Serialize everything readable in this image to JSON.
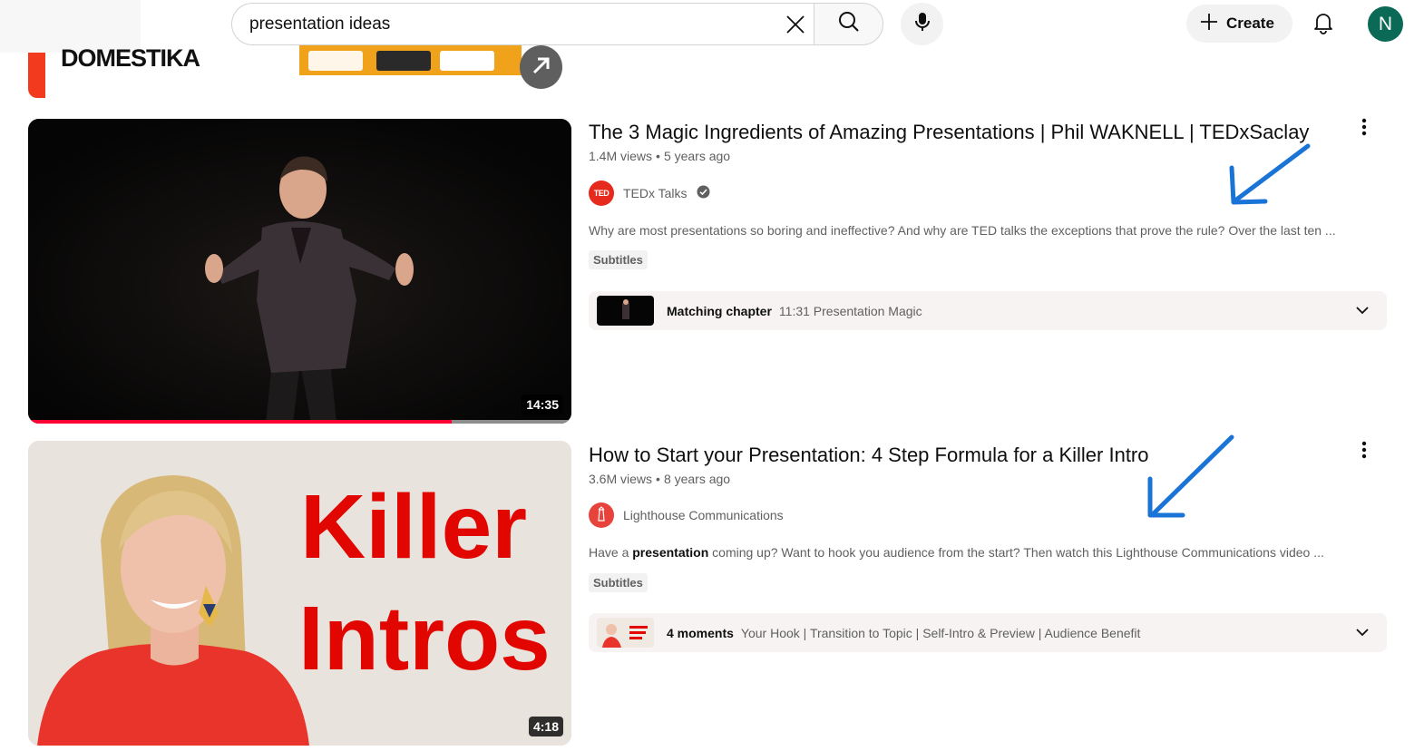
{
  "header": {
    "search_value": "presentation ideas",
    "search_placeholder": "Search",
    "create_label": "Create",
    "avatar_letter": "N"
  },
  "ad": {
    "brand": "DOMESTIKA"
  },
  "results": [
    {
      "title": "The 3 Magic Ingredients of Amazing Presentations | Phil WAKNELL | TEDxSaclay",
      "views": "1.4M views",
      "age": "5 years ago",
      "channel": "TEDx Talks",
      "channel_avatar_text": "TED",
      "verified": true,
      "description": "Why are most presentations so boring and ineffective? And why are TED talks the exceptions that prove the rule? Over the last ten ...",
      "badge": "Subtitles",
      "duration": "14:35",
      "watch_progress": 0.78,
      "chapter_label": "Matching chapter",
      "chapter_text": "11:31 Presentation Magic"
    },
    {
      "title": "How to Start your Presentation: 4 Step Formula for a Killer Intro",
      "views": "3.6M views",
      "age": "8 years ago",
      "channel": "Lighthouse Communications",
      "description_pre": "Have a ",
      "description_bold": "presentation",
      "description_post": " coming up? Want to hook you audience from the start? Then watch this Lighthouse Communications video ...",
      "badge": "Subtitles",
      "duration": "4:18",
      "thumb_text_1": "Killer",
      "thumb_text_2": "Intros",
      "chapter_label": "4 moments",
      "chapter_text": "Your Hook | Transition to Topic | Self-Intro & Preview | Audience Benefit"
    }
  ],
  "colors": {
    "annotation_arrow": "#1a73d6",
    "progress": "#ff0033",
    "avatar": "#0b6a55",
    "ted_red": "#e62b1e"
  }
}
